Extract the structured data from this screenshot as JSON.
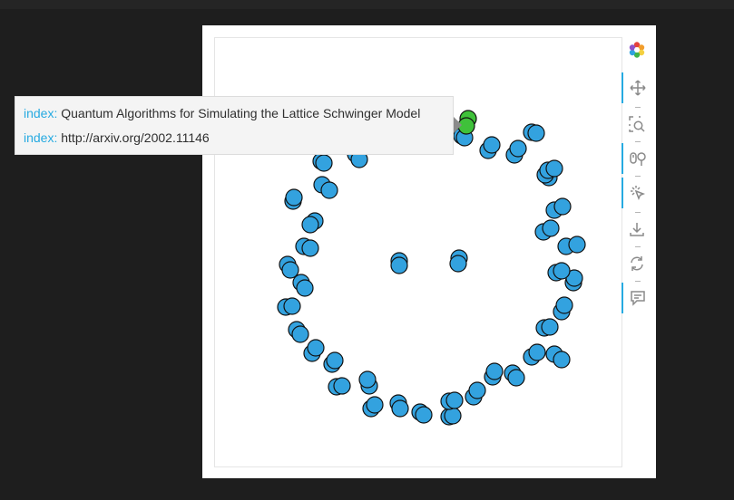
{
  "tooltip": {
    "rows": [
      {
        "key": "index:",
        "value": "Quantum Algorithms for Simulating the Lattice Schwinger Model"
      },
      {
        "key": "index:",
        "value": "http://arxiv.org/2002.11146"
      }
    ]
  },
  "toolbar": {
    "logo": "bokeh-logo-icon",
    "tools": [
      {
        "icon": "pan-icon",
        "active": true
      },
      {
        "icon": "box-zoom-icon",
        "active": false
      },
      {
        "icon": "wheel-zoom-icon",
        "active": true
      },
      {
        "icon": "tap-icon",
        "active": true
      },
      {
        "icon": "save-icon",
        "active": false
      },
      {
        "icon": "reset-icon",
        "active": false
      },
      {
        "icon": "hover-icon",
        "active": true
      }
    ]
  },
  "colors": {
    "node_fill": "#33a2df",
    "node_stroke": "#111111",
    "node_highlight": "#3fc13a",
    "tooltip_key": "#26aae1",
    "background": "#1e1e1e",
    "panel": "#ffffff"
  }
}
